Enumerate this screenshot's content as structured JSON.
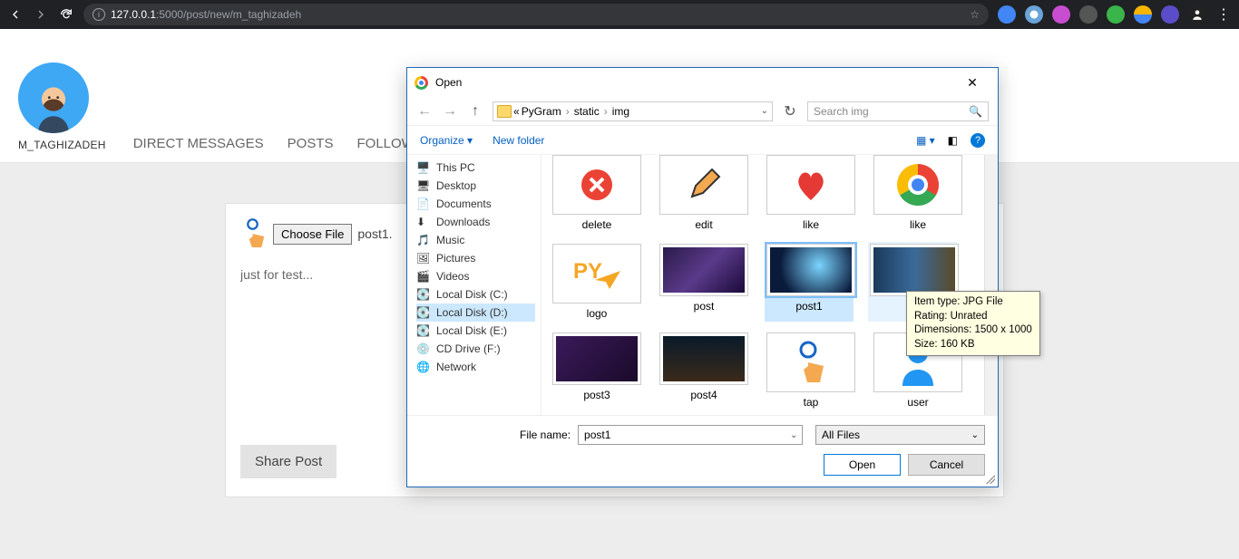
{
  "browser": {
    "url_host": "127.0.0.1",
    "url_path": ":5000/post/new/m_taghizadeh"
  },
  "header": {
    "username": "M_TAGHIZADEH",
    "nav": [
      "DIRECT MESSAGES",
      "POSTS",
      "FOLLOWER"
    ]
  },
  "form": {
    "choose_label": "Choose File",
    "file_text": "post1.",
    "caption": "just for test...",
    "share": "Share Post"
  },
  "dialog": {
    "title": "Open",
    "crumbs": [
      "PyGram",
      "static",
      "img"
    ],
    "search_placeholder": "Search img",
    "organize": "Organize",
    "new_folder": "New folder",
    "tree": [
      {
        "label": "This PC",
        "icon": "pc"
      },
      {
        "label": "Desktop",
        "icon": "desktop"
      },
      {
        "label": "Documents",
        "icon": "docs"
      },
      {
        "label": "Downloads",
        "icon": "dl"
      },
      {
        "label": "Music",
        "icon": "music"
      },
      {
        "label": "Pictures",
        "icon": "pics"
      },
      {
        "label": "Videos",
        "icon": "vid"
      },
      {
        "label": "Local Disk (C:)",
        "icon": "disk"
      },
      {
        "label": "Local Disk (D:)",
        "icon": "disk",
        "selected": true
      },
      {
        "label": "Local Disk (E:)",
        "icon": "disk"
      },
      {
        "label": "CD Drive (F:)",
        "icon": "cd"
      },
      {
        "label": "Network",
        "icon": "net"
      }
    ],
    "files": [
      {
        "name": "delete",
        "kind": "icon-x"
      },
      {
        "name": "edit",
        "kind": "icon-pencil"
      },
      {
        "name": "like",
        "kind": "icon-heart"
      },
      {
        "name": "like",
        "kind": "icon-chrome"
      },
      {
        "name": "logo",
        "kind": "icon-py"
      },
      {
        "name": "post",
        "kind": "photo1"
      },
      {
        "name": "post1",
        "kind": "photo2",
        "selected": true
      },
      {
        "name": "",
        "kind": "photo3",
        "hover": true
      },
      {
        "name": "post3",
        "kind": "photo4"
      },
      {
        "name": "post4",
        "kind": "photo5"
      },
      {
        "name": "tap",
        "kind": "icon-tap"
      },
      {
        "name": "user",
        "kind": "icon-user"
      }
    ],
    "filename_label": "File name:",
    "filename_value": "post1",
    "filter": "All Files",
    "open": "Open",
    "cancel": "Cancel"
  },
  "tooltip": {
    "l1": "Item type: JPG File",
    "l2": "Rating: Unrated",
    "l3": "Dimensions: 1500 x 1000",
    "l4": "Size: 160 KB"
  }
}
